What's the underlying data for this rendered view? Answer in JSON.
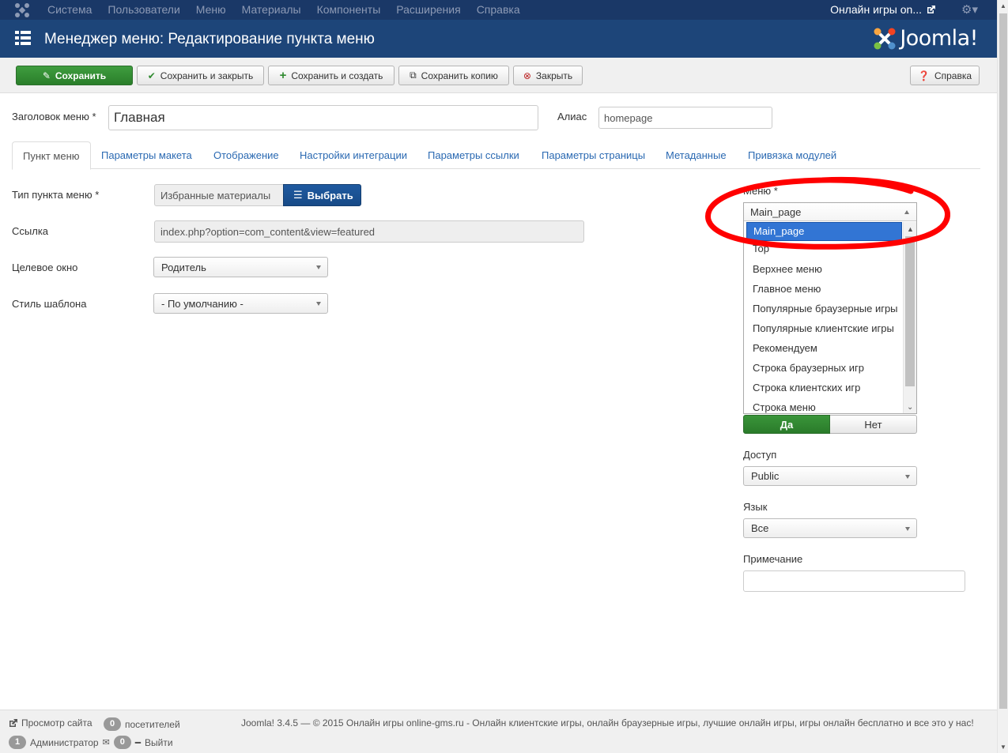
{
  "navbar": {
    "menu": [
      "Система",
      "Пользователи",
      "Меню",
      "Материалы",
      "Компоненты",
      "Расширения",
      "Справка"
    ],
    "site_link": "Онлайн игры on...",
    "icons": {
      "logo": "joomla-logo-icon",
      "external": "external-link-icon",
      "gear": "gear-icon"
    }
  },
  "header": {
    "title": "Менеджер меню: Редактирование пункта меню",
    "brand": "Joomla!"
  },
  "toolbar": {
    "save": "Сохранить",
    "save_close": "Сохранить и закрыть",
    "save_new": "Сохранить и создать",
    "save_copy": "Сохранить копию",
    "close": "Закрыть",
    "help": "Справка"
  },
  "form": {
    "title_label": "Заголовок меню *",
    "title_value": "Главная",
    "alias_label": "Алиас",
    "alias_value": "homepage"
  },
  "tabs": [
    "Пункт меню",
    "Параметры макета",
    "Отображение",
    "Настройки интеграции",
    "Параметры ссылки",
    "Параметры страницы",
    "Метаданные",
    "Привязка модулей"
  ],
  "details": {
    "type_label": "Тип пункта меню *",
    "type_value": "Избранные материалы",
    "select_button": "Выбрать",
    "link_label": "Ссылка",
    "link_value": "index.php?option=com_content&view=featured",
    "target_label": "Целевое окно",
    "target_value": "Родитель",
    "style_label": "Стиль шаблона",
    "style_value": "- По умолчанию -"
  },
  "sidebar": {
    "menu_label": "Меню *",
    "menu_value": "Main_page",
    "menu_options": [
      "Main_page",
      "Top",
      "Верхнее меню",
      "Главное меню",
      "Популярные браузерные игры",
      "Популярные клиентские игры",
      "Рекомендуем",
      "Строка браузерных игр",
      "Строка клиентских игр",
      "Строка меню"
    ],
    "toggle_yes": "Да",
    "toggle_no": "Нет",
    "access_label": "Доступ",
    "access_value": "Public",
    "language_label": "Язык",
    "language_value": "Все",
    "note_label": "Примечание",
    "note_value": ""
  },
  "footer": {
    "view_site": "Просмотр сайта",
    "visitors_count": "0",
    "visitors_label": "посетителей",
    "admin_count": "1",
    "admin_label": "Администратор",
    "messages_count": "0",
    "logout": "Выйти",
    "copyright": "Joomla! 3.4.5  —  © 2015 Онлайн игры online-gms.ru - Онлайн клиентские игры, онлайн браузерные игры, лучшие онлайн игры, игры онлайн бесплатно и все это у нас!"
  },
  "colors": {
    "navbar": "#1a3867",
    "header": "#1d4579",
    "success": "#2f8a2f",
    "primary": "#1f5aa0",
    "selected": "#3275d4",
    "annotation": "#ff0000"
  }
}
